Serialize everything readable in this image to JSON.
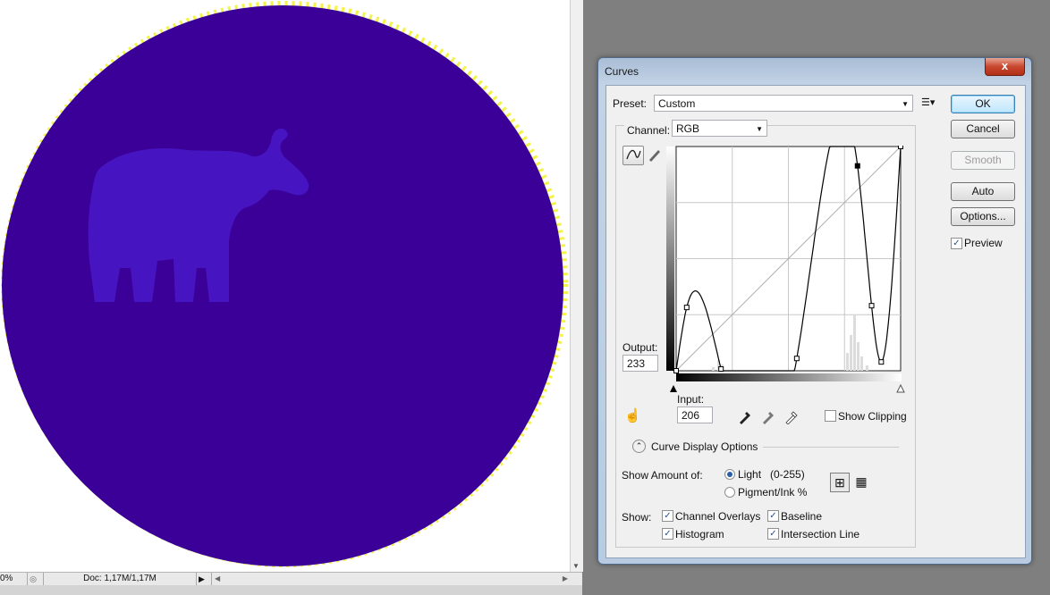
{
  "document": {
    "zoom": "0%",
    "doc_info": "Doc: 1,17M/1,17M",
    "colors": {
      "fill": "#3a0097",
      "figure": "#4a18c8",
      "fringe": "#f4f34a"
    }
  },
  "dialog": {
    "title": "Curves",
    "close_glyph": "x",
    "preset_label": "Preset:",
    "preset_value": "Custom",
    "channel_label": "Channel:",
    "channel_value": "RGB",
    "output_label": "Output:",
    "output_value": "233",
    "input_label": "Input:",
    "input_value": "206",
    "show_clipping": "Show Clipping",
    "buttons": {
      "ok": "OK",
      "cancel": "Cancel",
      "smooth": "Smooth",
      "auto": "Auto",
      "options": "Options..."
    },
    "preview_label": "Preview",
    "preview_checked": true,
    "display_options": {
      "title": "Curve Display Options",
      "show_amount_label": "Show Amount of:",
      "light_label": "Light",
      "light_range": "(0-255)",
      "pigment_label": "Pigment/Ink %",
      "show_label": "Show:",
      "channel_overlays": "Channel Overlays",
      "baseline": "Baseline",
      "histogram": "Histogram",
      "intersection_line": "Intersection Line"
    }
  },
  "curve": {
    "control_points": [
      [
        0,
        0
      ],
      [
        12,
        72
      ],
      [
        51,
        2
      ],
      [
        137,
        14
      ],
      [
        206,
        233
      ],
      [
        222,
        74
      ],
      [
        233,
        10
      ],
      [
        255,
        255
      ]
    ],
    "selected_point": [
      206,
      233
    ]
  }
}
